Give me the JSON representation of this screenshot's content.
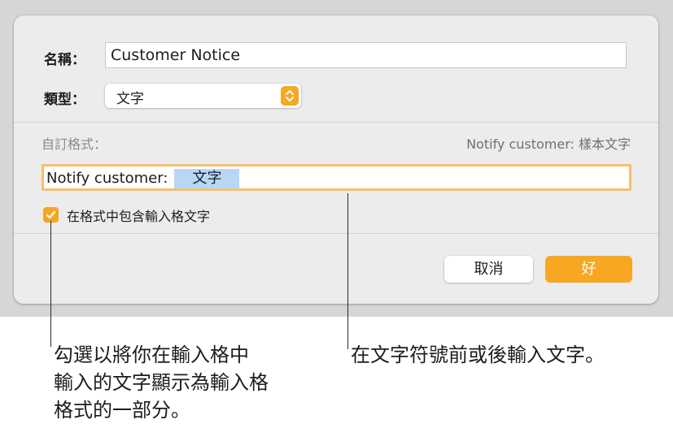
{
  "dialog": {
    "name_label": "名稱：",
    "name_value": "Customer Notice",
    "type_label": "類型：",
    "type_value": "文字",
    "custom_format_label": "自訂格式：",
    "sample_text": "Notify customer: 樣本文字",
    "format_prefix": "Notify customer:",
    "format_token": "文字",
    "include_checkbox_label": "在格式中包含輸入格文字",
    "include_checked": true,
    "cancel_label": "取消",
    "ok_label": "好",
    "accent_color": "#f7a721"
  },
  "callouts": {
    "left_text": "勾選以將你在輸入格中\n輸入的文字顯示為輸入格\n格式的一部分。",
    "left_lines": [
      "勾選以將你在輸入格中",
      "輸入的文字顯示為輸入格",
      "格式的一部分。"
    ],
    "right_text": "在文字符號前或後輸入文字。"
  }
}
